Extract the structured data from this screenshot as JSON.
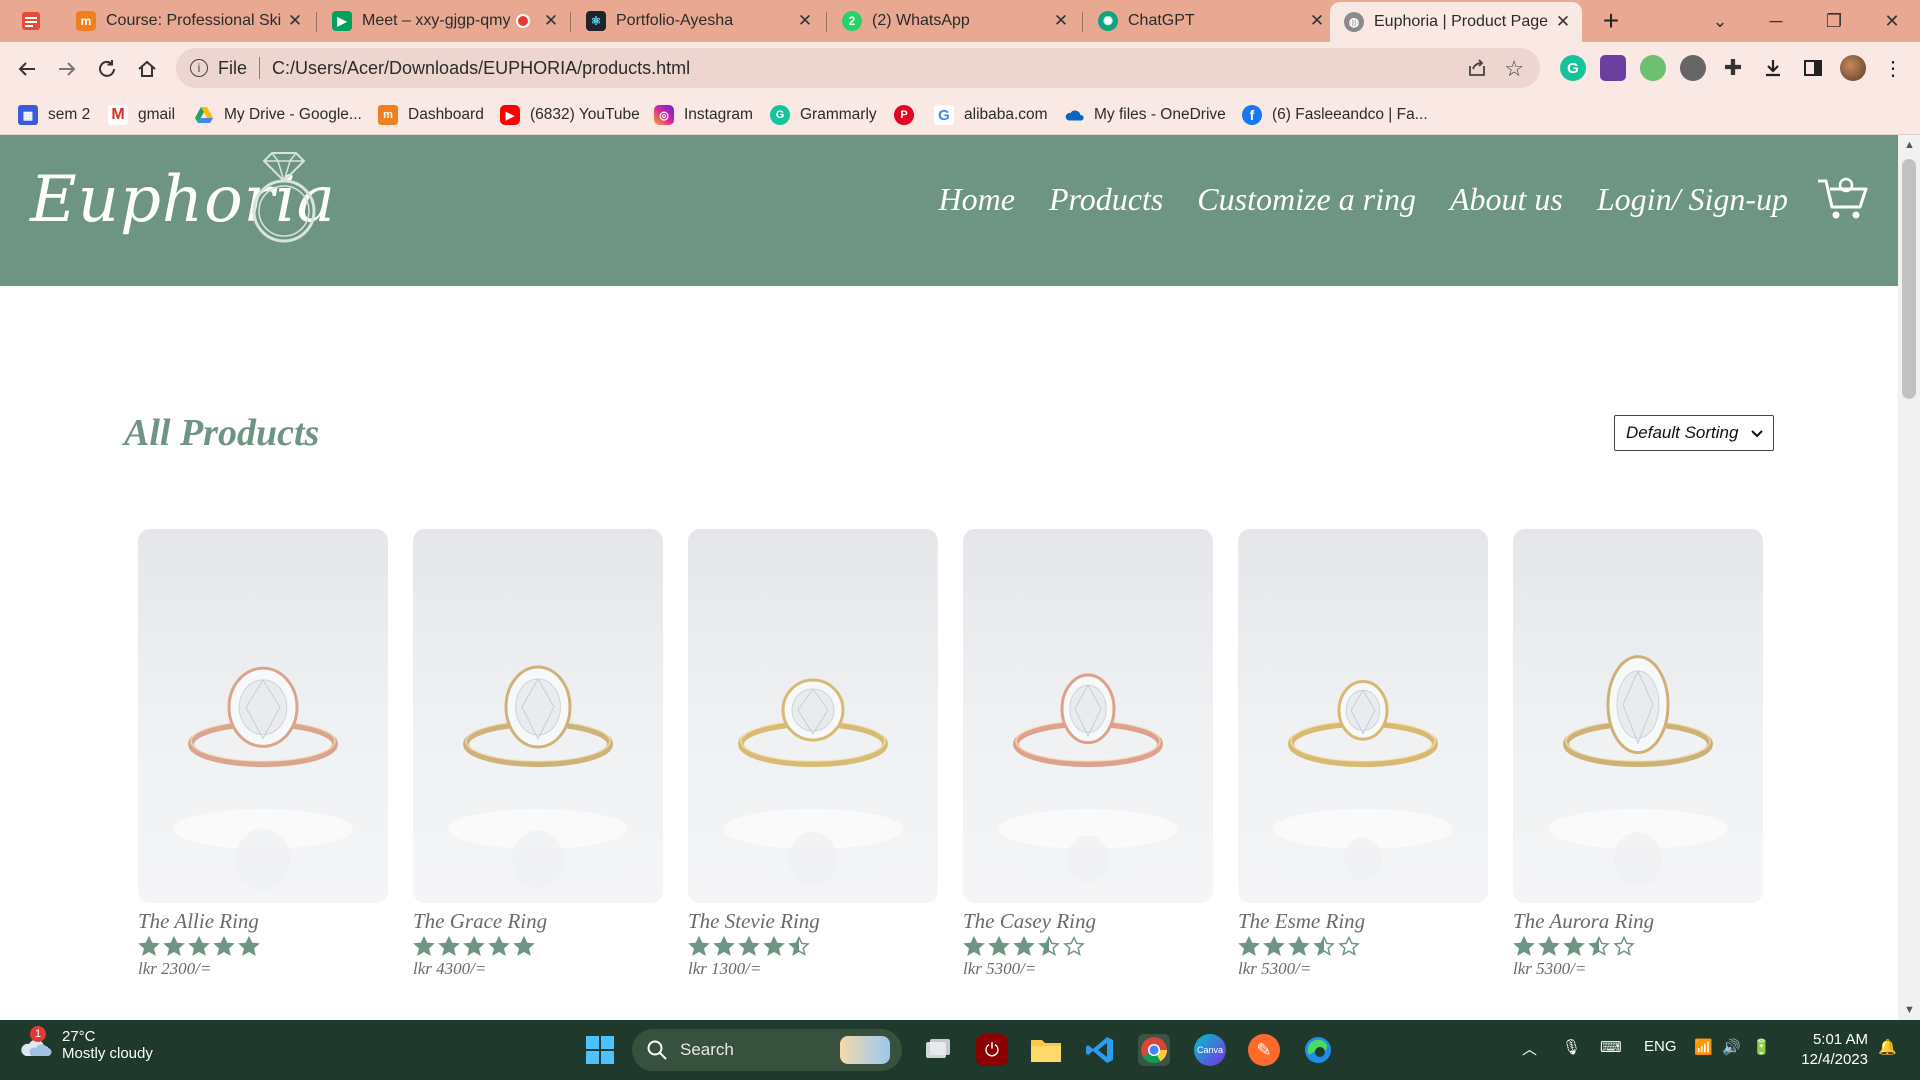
{
  "browser": {
    "tabs": [
      {
        "title": "Course: Professional Skills",
        "favicon": "moodle-icon",
        "color": "#f0801f"
      },
      {
        "title": "Meet – xxy-gjgp-qmy",
        "favicon": "meet-icon",
        "color": "#00a15c"
      },
      {
        "title": "Portfolio-Ayesha",
        "favicon": "react-icon",
        "color": "#20232a"
      },
      {
        "title": "(2) WhatsApp",
        "favicon": "whatsapp-icon",
        "color": "#25d366"
      },
      {
        "title": "ChatGPT",
        "favicon": "chatgpt-icon",
        "color": "#10a37f"
      },
      {
        "title": "Euphoria | Product Page",
        "favicon": "globe-icon",
        "color": "#777777"
      }
    ],
    "address": {
      "scheme_label": "File",
      "url": "C:/Users/Acer/Downloads/EUPHORIA/products.html"
    },
    "bookmarks": [
      {
        "label": "sem 2",
        "icon": "calendar-icon",
        "color": "#3b5bdb"
      },
      {
        "label": "gmail",
        "icon": "gmail-icon",
        "color": "#d93025"
      },
      {
        "label": "My Drive - Google...",
        "icon": "drive-icon",
        "color": "#1fa463"
      },
      {
        "label": "Dashboard",
        "icon": "moodle-icon",
        "color": "#f0801f"
      },
      {
        "label": "(6832) YouTube",
        "icon": "youtube-icon",
        "color": "#ff0000"
      },
      {
        "label": "Instagram",
        "icon": "instagram-icon",
        "color": "#d6249f"
      },
      {
        "label": "Grammarly",
        "icon": "grammarly-icon",
        "color": "#15c39a"
      },
      {
        "label": "",
        "icon": "pinterest-icon",
        "color": "#e60023"
      },
      {
        "label": "alibaba.com",
        "icon": "google-icon",
        "color": "#4285f4"
      },
      {
        "label": "My files - OneDrive",
        "icon": "onedrive-icon",
        "color": "#0a66c2"
      },
      {
        "label": "(6) Fasleeandco | Fa...",
        "icon": "facebook-icon",
        "color": "#1877f2"
      }
    ]
  },
  "site": {
    "logo": "Euphoria",
    "nav": [
      "Home",
      "Products",
      "Customize a ring",
      "About us",
      "Login/ Sign-up"
    ],
    "brand_color": "#6e9583"
  },
  "main": {
    "heading": "All Products",
    "sort_label": "Default Sorting",
    "products": [
      {
        "name": "The Allie Ring",
        "rating": 5,
        "price": "lkr 2300/=",
        "metal": "#d9a58d"
      },
      {
        "name": "The Grace Ring",
        "rating": 5,
        "price": "lkr 4300/=",
        "metal": "#cfb27a"
      },
      {
        "name": "The Stevie Ring",
        "rating": 4.5,
        "price": "lkr 1300/=",
        "metal": "#d8bb72"
      },
      {
        "name": "The Casey Ring",
        "rating": 3.5,
        "price": "lkr 5300/=",
        "metal": "#dea28c"
      },
      {
        "name": "The Esme Ring",
        "rating": 3.5,
        "price": "lkr 5300/=",
        "metal": "#d9b870"
      },
      {
        "name": "The Aurora Ring",
        "rating": 3.5,
        "price": "lkr 5300/=",
        "metal": "#ceb174"
      }
    ]
  },
  "taskbar": {
    "weather_temp": "27°C",
    "weather_text": "Mostly cloudy",
    "weather_badge": "1",
    "search_label": "Search",
    "lang": "ENG",
    "time": "5:01 AM",
    "date": "12/4/2023"
  }
}
